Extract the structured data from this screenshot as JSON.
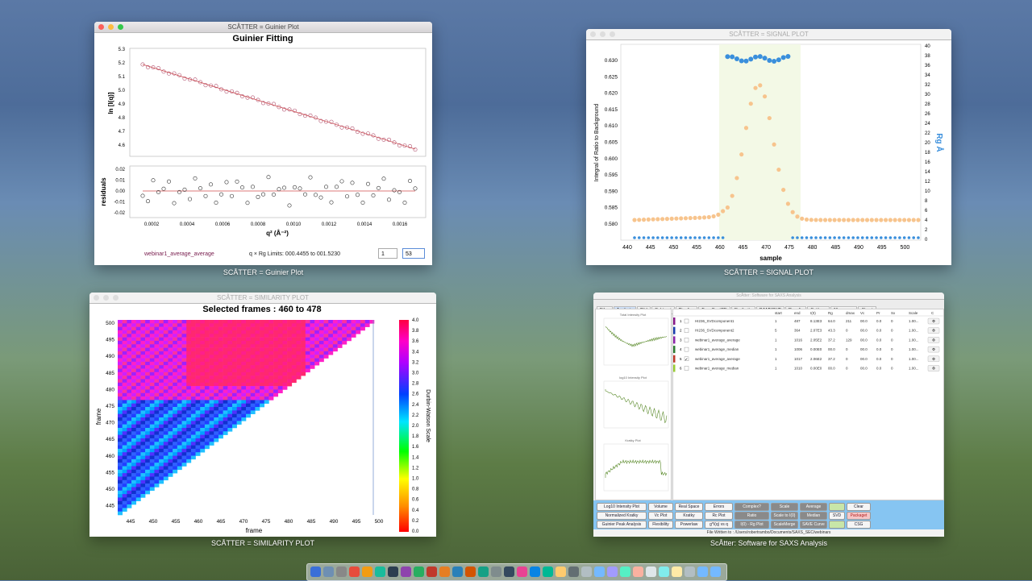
{
  "guinier": {
    "window_title": "SCÅTTER = Guinier Plot",
    "caption": "SCÅTTER = Guinier Plot",
    "chart_title": "Guinier Fitting",
    "ylabel": "ln [I(q)]",
    "resid_label": "residuals",
    "xlabel": "q² (Å⁻²)",
    "yticks": [
      "5.3",
      "5.2",
      "5.1",
      "5.0",
      "4.9",
      "4.8",
      "4.7",
      "4.6"
    ],
    "rticks": [
      "0.02",
      "0.01",
      "0.00",
      "-0.01",
      "-0.02"
    ],
    "xticks": [
      "0.0002",
      "0.0004",
      "0.0006",
      "0.0008",
      "0.0010",
      "0.0012",
      "0.0014",
      "0.0016"
    ],
    "dataset_name": "webinar1_average_average",
    "limits_text": "q × Rg Limits: 000.4455 to 001.5230",
    "spinner_start": "1",
    "spinner_end": "53",
    "colors": {
      "points": "#b0506e",
      "fit": "#d24c4c"
    }
  },
  "signal": {
    "window_title": "SCÅTTER = SIGNAL PLOT",
    "caption": "SCÅTTER = SIGNAL PLOT",
    "ylabel": "Integral of Ratio to Background",
    "right_label": "Rg Å",
    "xlabel": "sample",
    "yticks": [
      "0.630",
      "0.625",
      "0.620",
      "0.615",
      "0.610",
      "0.605",
      "0.600",
      "0.595",
      "0.590",
      "0.585",
      "0.580"
    ],
    "rticks": [
      "40",
      "38",
      "36",
      "34",
      "32",
      "30",
      "28",
      "26",
      "24",
      "22",
      "20",
      "18",
      "16",
      "14",
      "12",
      "10",
      "8",
      "6",
      "4",
      "2",
      "0"
    ],
    "xticks": [
      "440",
      "445",
      "450",
      "455",
      "460",
      "465",
      "470",
      "475",
      "480",
      "485",
      "490",
      "495",
      "500"
    ],
    "colors": {
      "signal": "#f7c48d",
      "rg": "#3a8fdc",
      "band": "#f3f9e6"
    }
  },
  "similarity": {
    "window_title": "SCÅTTER = SIMILARITY PLOT",
    "caption": "SCÅTTER = SIMILARITY PLOT",
    "chart_title": "Selected frames : 460 to 478",
    "ylabel": "frame",
    "xlabel": "frame",
    "scale_label": "Durbin-Watson Scale",
    "yticks": [
      "500",
      "495",
      "490",
      "485",
      "480",
      "475",
      "470",
      "465",
      "460",
      "455",
      "450",
      "445"
    ],
    "xticks": [
      "445",
      "450",
      "455",
      "460",
      "465",
      "470",
      "475",
      "480",
      "485",
      "490",
      "495",
      "500"
    ],
    "scale_ticks": [
      "4.0",
      "3.8",
      "3.6",
      "3.4",
      "3.2",
      "3.0",
      "2.8",
      "2.6",
      "2.4",
      "2.2",
      "2.0",
      "1.8",
      "1.6",
      "1.4",
      "1.2",
      "1.0",
      "0.8",
      "0.6",
      "0.4",
      "0.2",
      "0.0"
    ]
  },
  "app": {
    "window_title": "ScÅtter: Software for SAXS Analysis",
    "caption": "ScÅtter: Software for SAXS Analysis",
    "tabs": [
      "Files",
      "Analysis",
      "P(r)",
      "Subtract",
      "Pipeline",
      "FormFactCE",
      "Similarity",
      "DAMMIN/F",
      "Results",
      "Settings",
      "Messages",
      "About"
    ],
    "active_tab": "Analysis",
    "mini_plots": [
      "Total Intensity Plot",
      "log10 Intensity Plot",
      "Kratky Plot"
    ],
    "table_headers": [
      "",
      "",
      "",
      "start",
      "end",
      "I(0)",
      "Rg",
      "dmax",
      "Vc",
      "Pr",
      "Sx",
      "Scale",
      "C"
    ],
    "rows": [
      {
        "n": "1",
        "name": "HI236_SVDcomponent1",
        "start": "1",
        "end": "487",
        "i0": "8.13E3",
        "rg": "64.0",
        "dmax": "211",
        "vc": "00.0",
        "pr": "0.0",
        "sx": "0",
        "scale": "1.00...",
        "color": "#8a1a8a",
        "checked": false
      },
      {
        "n": "2",
        "name": "HI236_SVDcomponent2",
        "start": "5",
        "end": "364",
        "i0": "2.07E3",
        "rg": "43.3",
        "dmax": "0",
        "vc": "00.0",
        "pr": "0.0",
        "sx": "0",
        "scale": "1.00...",
        "color": "#1a3fb0",
        "checked": false
      },
      {
        "n": "3",
        "name": "webinar1_average_average",
        "start": "1",
        "end": "1016",
        "i0": "2.05E2",
        "rg": "37.2",
        "dmax": "129",
        "vc": "00.0",
        "pr": "0.0",
        "sx": "0",
        "scale": "1.00...",
        "color": "#8e24aa",
        "checked": false
      },
      {
        "n": "4",
        "name": "webinar1_average_median",
        "start": "1",
        "end": "1006",
        "i0": "0.00E0",
        "rg": "00.0",
        "dmax": "0",
        "vc": "00.0",
        "pr": "0.0",
        "sx": "0",
        "scale": "1.00...",
        "color": "#2e7d32",
        "checked": false
      },
      {
        "n": "5",
        "name": "webinar1_average_average",
        "start": "1",
        "end": "1017",
        "i0": "2.06E2",
        "rg": "37.2",
        "dmax": "0",
        "vc": "00.0",
        "pr": "0.0",
        "sx": "0",
        "scale": "1.00...",
        "color": "#c0392b",
        "checked": true
      },
      {
        "n": "6",
        "name": "webinar1_average_median",
        "start": "1",
        "end": "1010",
        "i0": "0.00E0",
        "rg": "00.0",
        "dmax": "0",
        "vc": "00.0",
        "pr": "0.0",
        "sx": "0",
        "scale": "1.00...",
        "color": "#9acd32",
        "checked": false
      }
    ],
    "buttons_row1": [
      "Log10 Intensity Plot",
      "Volume",
      "Real Space",
      "Errors",
      "Complex?",
      "Scale",
      "Average",
      "",
      "Clear"
    ],
    "buttons_row2": [
      "Normalized Kratky",
      "Vc Plot",
      "Kratky",
      "Rc Plot",
      "Ratio",
      "Scale to I(0)",
      "Median",
      "SVD",
      "Packaget"
    ],
    "buttons_row3": [
      "Guinier Peak Analysis",
      "Flexibility",
      "Powerlaw",
      "g*I(q) vs q",
      "I(0) - Rg Plot",
      "ScaleMerge",
      "SAVE Curve",
      "",
      "CSG"
    ],
    "status_text": "File Written to : /Users/robertrambo/Documents/SAXS_SEC/webinars"
  }
}
